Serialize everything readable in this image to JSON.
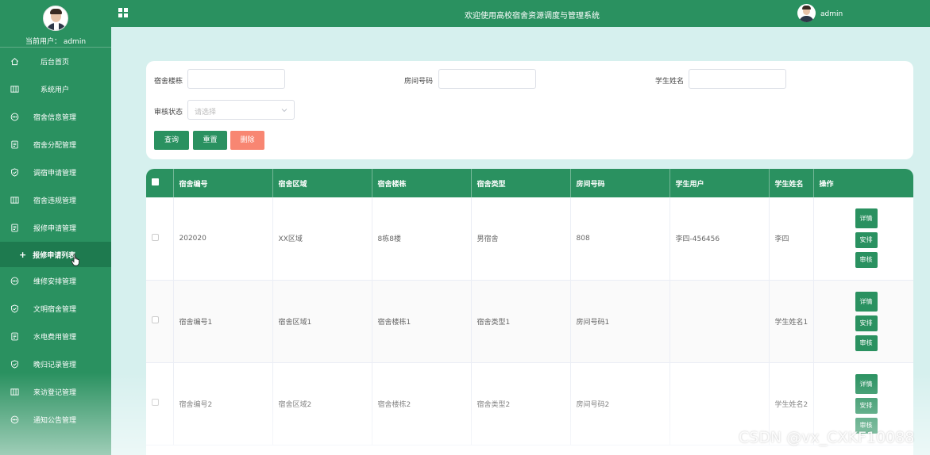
{
  "sidebar": {
    "current_user": "当前用户： admin",
    "items": [
      {
        "label": "后台首页",
        "icon": "home-icon"
      },
      {
        "label": "系统用户",
        "icon": "columns-icon"
      },
      {
        "label": "宿舍信息管理",
        "icon": "chat-icon"
      },
      {
        "label": "宿舍分配管理",
        "icon": "document-icon"
      },
      {
        "label": "调宿申请管理",
        "icon": "shield-check-icon"
      },
      {
        "label": "宿舍违规管理",
        "icon": "columns-icon"
      },
      {
        "label": "报修申请管理",
        "icon": "document-icon"
      },
      {
        "label": "维修安排管理",
        "icon": "chat-icon"
      },
      {
        "label": "文明宿舍管理",
        "icon": "shield-check-icon"
      },
      {
        "label": "水电费用管理",
        "icon": "document-icon"
      },
      {
        "label": "晚归记录管理",
        "icon": "shield-check-icon"
      },
      {
        "label": "来访登记管理",
        "icon": "columns-icon"
      },
      {
        "label": "通知公告管理",
        "icon": "chat-icon"
      }
    ],
    "submenu": {
      "plus": "+",
      "label": "报修申请列表"
    }
  },
  "header": {
    "title": "欢迎使用高校宿舍资源调度与管理系统",
    "username": "admin"
  },
  "search": {
    "building_label": "宿舍楼栋",
    "room_label": "房间号码",
    "student_label": "学生姓名",
    "status_label": "审核状态",
    "status_placeholder": "请选择",
    "query_button": "查询",
    "reset_button": "重置",
    "delete_button": "删除"
  },
  "table": {
    "columns": [
      "宿舍编号",
      "宿舍区域",
      "宿舍楼栋",
      "宿舍类型",
      "房间号码",
      "学生用户",
      "学生姓名",
      "操作"
    ],
    "rows": [
      [
        "202020",
        "XX区域",
        "8栋8楼",
        "男宿舍",
        "808",
        "李四-456456",
        "李四"
      ],
      [
        "宿舍编号1",
        "宿舍区域1",
        "宿舍楼栋1",
        "宿舍类型1",
        "房间号码1",
        "",
        "学生姓名1"
      ],
      [
        "宿舍编号2",
        "宿舍区域2",
        "宿舍楼栋2",
        "宿舍类型2",
        "房间号码2",
        "",
        "学生姓名2"
      ]
    ],
    "actions": {
      "detail": "详情",
      "arrange": "安排",
      "review": "审核"
    }
  },
  "watermark": "CSDN @vx_CXKF10088",
  "colors": {
    "primary": "#2a9160",
    "danger": "#f88672",
    "background": "#d6f0ee"
  }
}
